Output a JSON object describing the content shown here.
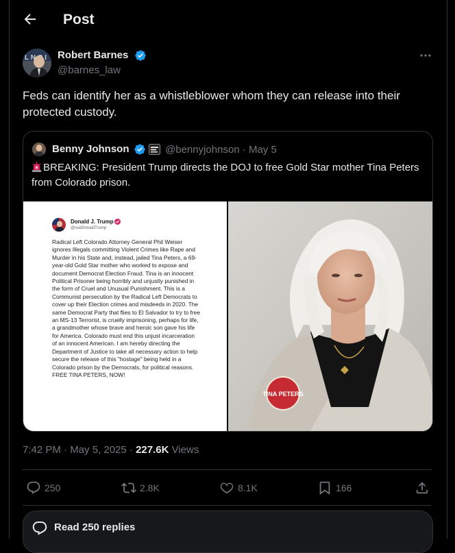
{
  "header": {
    "title": "Post"
  },
  "author": {
    "name": "Robert Barnes",
    "handle": "@barnes_law"
  },
  "tweet": {
    "text": "Feds can identify her as a whistleblower whom they can release into their protected custody."
  },
  "quote": {
    "name": "Benny Johnson",
    "handle_date": "@bennyjohnson · May 5",
    "text": "BREAKING: President Trump directs the DOJ to free Gold Star mother Tina Peters from Colorado prison.",
    "embedded_post": {
      "name": "Donald J. Trump",
      "handle": "@realDonaldTrump",
      "body": "Radical Left Colorado Attorney General Phil Weiser ignores Illegals committing Violent Crimes like Rape and Murder in his State and, instead, jailed Tina Peters, a 69-year-old Gold Star mother who worked to expose and document Democrat Election Fraud. Tina is an innocent Political Prisoner being horribly and unjustly punished in the form of Cruel and Unusual Punishment. This is a Communist persecution by the Radical Left Democrats to cover up their Election crimes and misdeeds in 2020. The same Democrat Party that flies to El Salvador to try to free an MS-13 Terrorist, is cruelly imprisoning, perhaps for life, a grandmother whose brave and heroic son gave his life for America. Colorado must end this unjust incarceration of an innocent American. I am hereby directing the Department of Justice to take all necessary action to help secure the release of this \"hostage\" being held in a Colorado prison by the Democrats, for political reasons. FREE TINA PETERS, NOW!"
    },
    "photo_button_text": "TINA PETERS"
  },
  "meta": {
    "time_date": "7:42 PM · May 5, 2025 · ",
    "views_count": "227.6K",
    "views_label": " Views"
  },
  "actions": {
    "replies": "250",
    "reposts": "2.8K",
    "likes": "8.1K",
    "bookmarks": "166"
  },
  "read_replies": {
    "label": "Read 250 replies"
  },
  "colors": {
    "background": "#000000",
    "text": "#e7e9ea",
    "muted": "#71767b",
    "border": "#2f3336",
    "verified_blue": "#1d9bf0"
  }
}
